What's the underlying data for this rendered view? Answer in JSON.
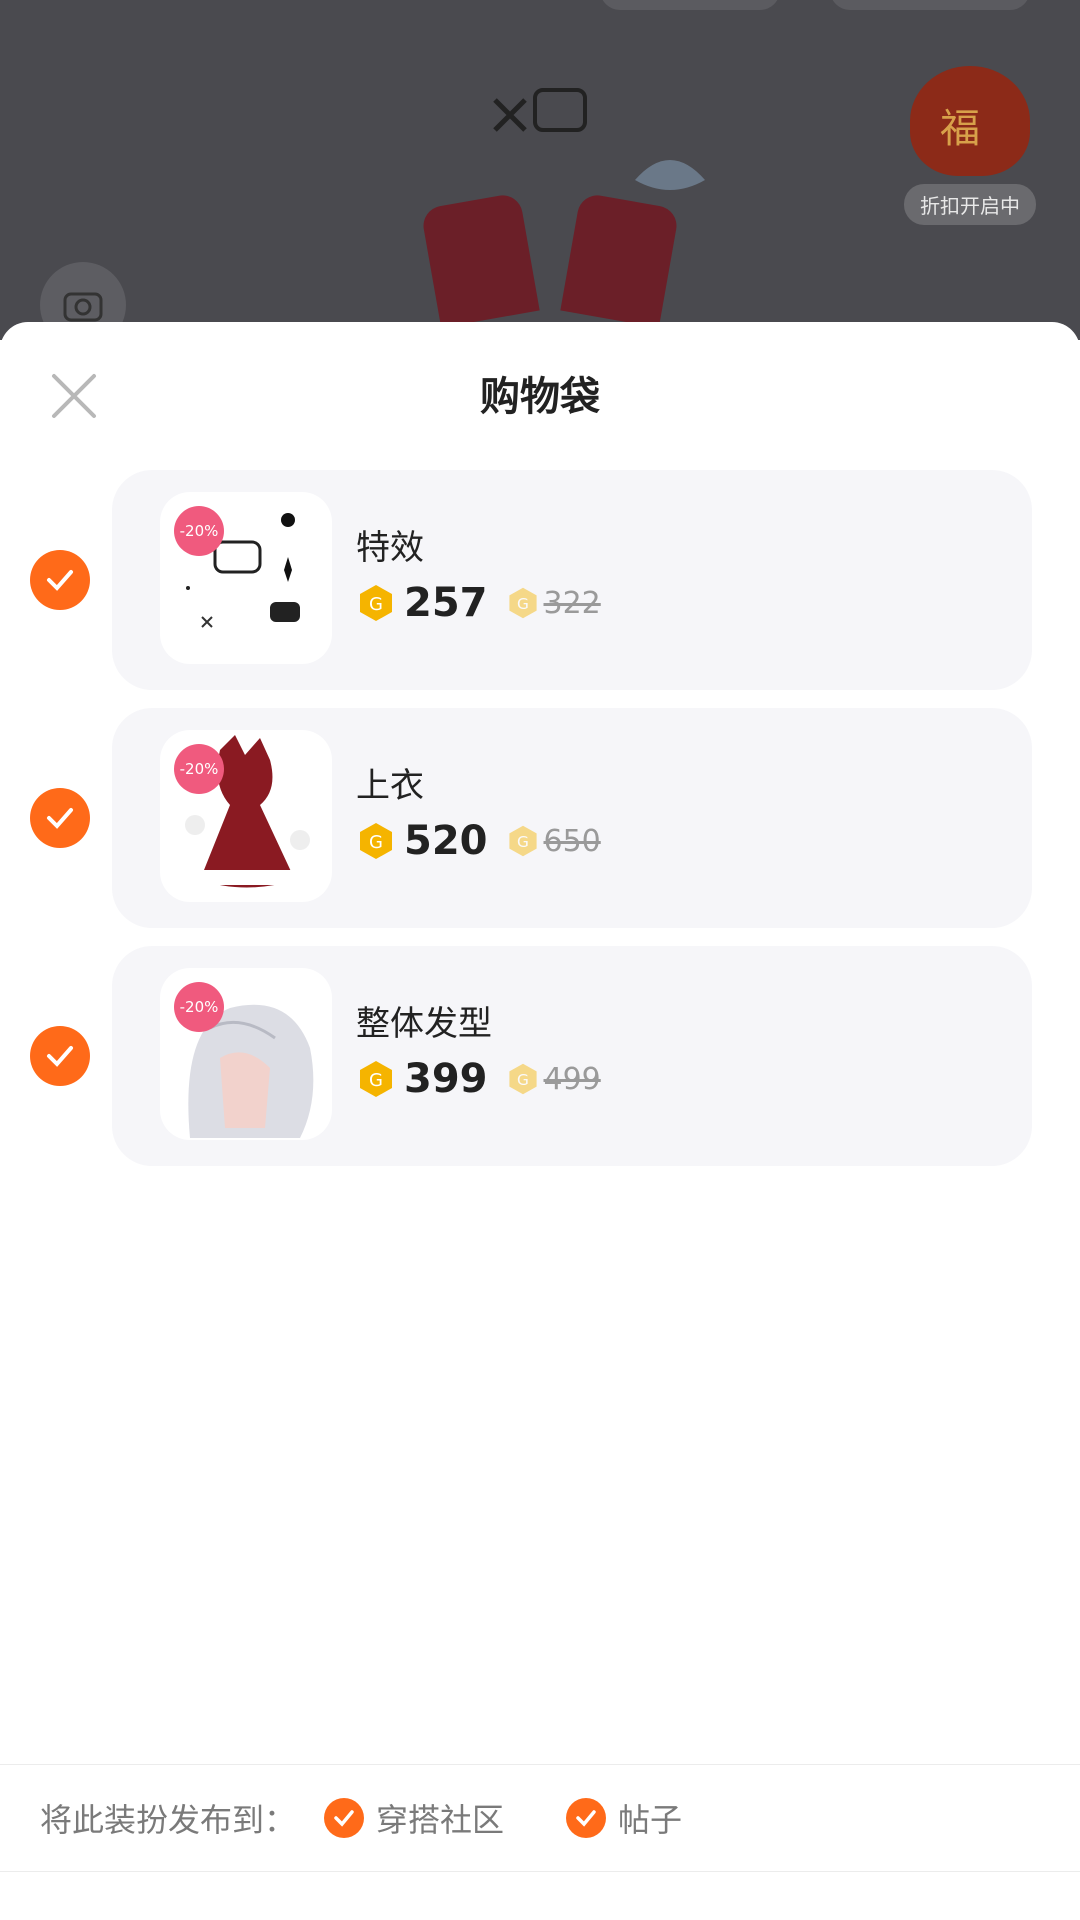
{
  "promo": {
    "label": "折扣开启中",
    "bag_char": "福"
  },
  "sheet": {
    "title": "购物袋"
  },
  "items": [
    {
      "name": "特效",
      "badge": "-20%",
      "price": "257",
      "old_price": "322",
      "checked": true
    },
    {
      "name": "上衣",
      "badge": "-20%",
      "price": "520",
      "old_price": "650",
      "checked": true
    },
    {
      "name": "整体发型",
      "badge": "-20%",
      "price": "399",
      "old_price": "499",
      "checked": true
    }
  ],
  "footer": {
    "prefix": "将此装扮发布到：",
    "options": [
      {
        "label": "穿搭社区",
        "checked": true
      },
      {
        "label": "帖子",
        "checked": true
      }
    ]
  },
  "colors": {
    "accent": "#ff6a19",
    "badge": "#f05a7e",
    "coin": "#f5b400"
  },
  "icons": {
    "close": "close-icon",
    "check": "check-icon",
    "coin": "coin-icon",
    "camera": "camera-icon"
  }
}
